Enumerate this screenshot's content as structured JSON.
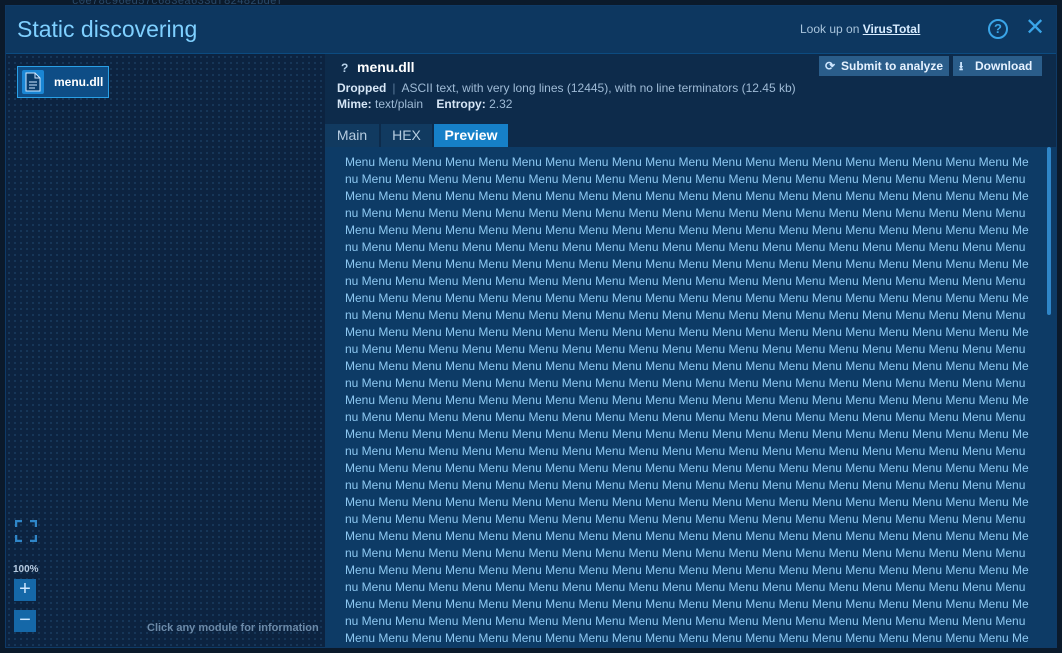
{
  "background": {
    "hash_fragment": "c0e78c96ed57c683ea633df82482bdef"
  },
  "window": {
    "title": "Static discovering",
    "lookup_prefix": "Look up on",
    "lookup_link": "VirusTotal",
    "help_icon": "?",
    "close_icon": "✕"
  },
  "left_panel": {
    "module_label": "menu.dll",
    "zoom_level": "100%",
    "zoom_in": "+",
    "zoom_out": "−",
    "hint": "Click any module for information"
  },
  "file": {
    "icon_char": "?",
    "name": "menu.dll",
    "status_label": "Dropped",
    "description": "ASCII text, with very long lines (12445), with no line terminators (12.45 kb)",
    "mime_label": "Mime:",
    "mime_value": "text/plain",
    "entropy_label": "Entropy:",
    "entropy_value": "2.32"
  },
  "actions": {
    "submit_label": "Submit to analyze",
    "download_label": "Download"
  },
  "tabs": {
    "main": "Main",
    "hex": "HEX",
    "preview": "Preview",
    "active": "Preview"
  },
  "preview": {
    "repeat_word": "Menu",
    "repeat_count": 700
  },
  "colors": {
    "accent": "#1680c8",
    "title": "#7fd0ff",
    "preview_text": "#8ec9f2"
  }
}
